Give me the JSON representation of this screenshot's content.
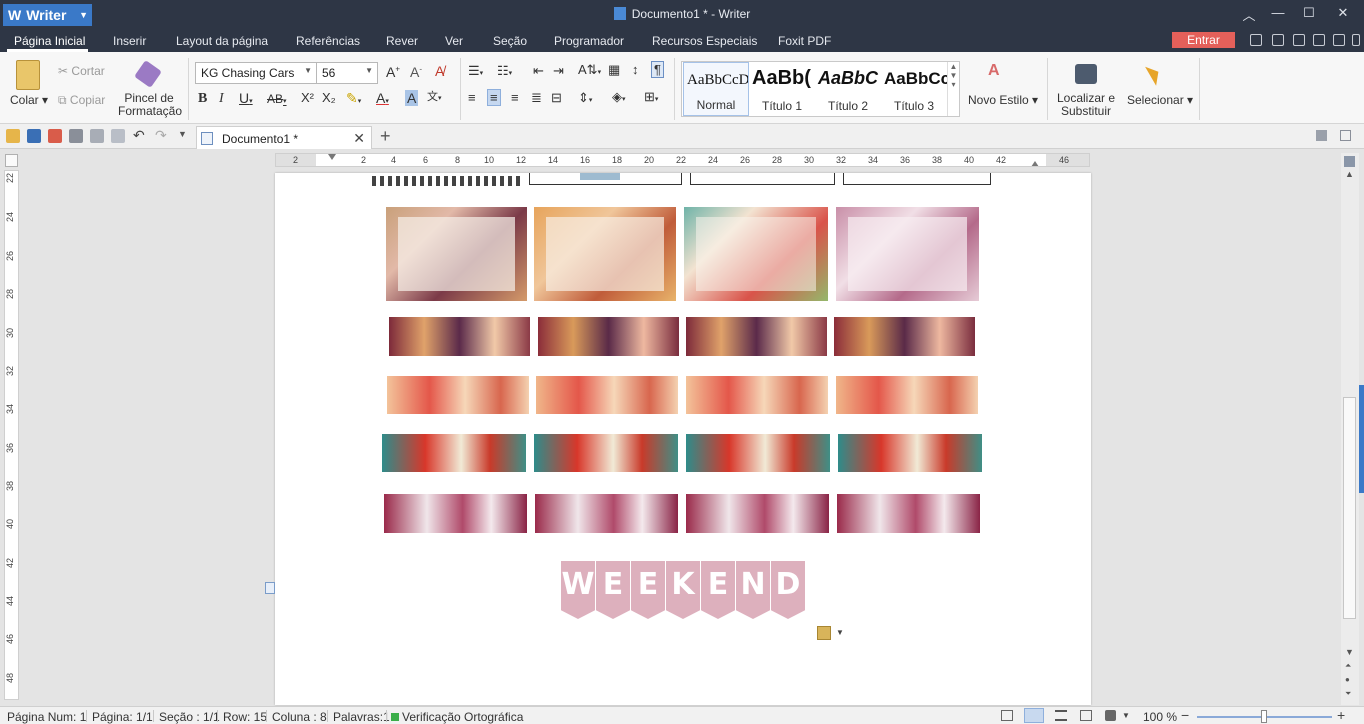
{
  "titlebar": {
    "app_name": "Writer",
    "document_title": "Documento1 * - Writer"
  },
  "menu": {
    "items": [
      "Página Inicial",
      "Inserir",
      "Layout da página",
      "Referências",
      "Rever",
      "Ver",
      "Seção",
      "Programador",
      "Recursos Especiais",
      "Foxit PDF"
    ],
    "active": "Página Inicial",
    "login_label": "Entrar"
  },
  "ribbon": {
    "paste_label": "Colar",
    "cut_label": "Cortar",
    "copy_label": "Copiar",
    "format_painter_label": "Pincel de Formatação",
    "font_name": "KG Chasing Cars",
    "font_size": "56",
    "styles": [
      {
        "sample": "AaBbCcDd",
        "name": "Normal"
      },
      {
        "sample": "AaBb(",
        "name": "Título 1"
      },
      {
        "sample": "AaBbC",
        "name": "Título 2"
      },
      {
        "sample": "AaBbCc",
        "name": "Título 3"
      }
    ],
    "new_style_label": "Novo Estilo",
    "find_replace_label": "Localizar e Substituir",
    "select_label": "Selecionar"
  },
  "tabs": {
    "document_tab": "Documento1 *"
  },
  "ruler": {
    "h_marks": [
      "2",
      "2",
      "4",
      "6",
      "8",
      "10",
      "12",
      "14",
      "16",
      "18",
      "20",
      "22",
      "24",
      "26",
      "28",
      "30",
      "32",
      "34",
      "36",
      "38",
      "40",
      "42",
      "46"
    ],
    "v_marks": [
      "22",
      "24",
      "26",
      "28",
      "30",
      "32",
      "34",
      "36",
      "38",
      "40",
      "42",
      "44",
      "46",
      "48"
    ]
  },
  "document": {
    "banner_letters": [
      "W",
      "E",
      "E",
      "K",
      "E",
      "N",
      "D"
    ]
  },
  "status": {
    "page_num": "Página Num: 1",
    "page": "Página: 1/1",
    "section": "Seção : 1/1",
    "row": "Row: 15",
    "column": "Coluna : 8",
    "words": "Palavras:1",
    "spellcheck": "Verificação Ortográfica",
    "zoom": "100 %"
  },
  "colors": {
    "titlebar": "#2e3645",
    "accent": "#3a79c8",
    "login": "#e4605a",
    "banner_pink": "#ddb0bd"
  }
}
